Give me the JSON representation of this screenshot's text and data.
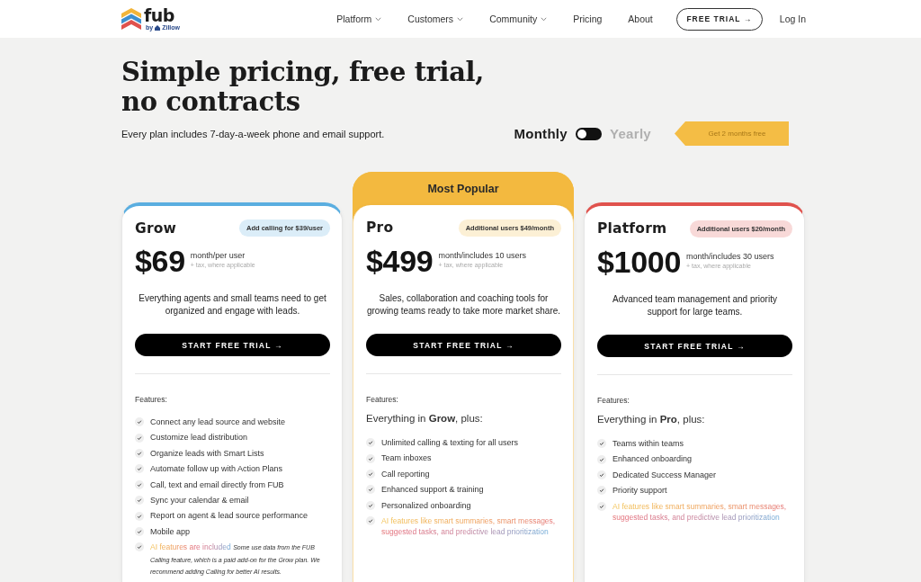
{
  "header": {
    "brand": "fub",
    "byline": {
      "prefix": "by",
      "partner": "Zillow"
    },
    "nav": [
      {
        "label": "Platform",
        "has_menu": true
      },
      {
        "label": "Customers",
        "has_menu": true
      },
      {
        "label": "Community",
        "has_menu": true
      },
      {
        "label": "Pricing",
        "has_menu": false
      },
      {
        "label": "About",
        "has_menu": false
      }
    ],
    "trial_button": "FREE TRIAL →",
    "login": "Log In"
  },
  "hero": {
    "title": "Simple pricing, free trial, no contracts",
    "subtitle": "Every plan includes 7-day-a-week phone and email support."
  },
  "billing": {
    "options": [
      {
        "label": "Monthly",
        "selected": true
      },
      {
        "label": "Yearly",
        "selected": false
      }
    ],
    "promo": "Get 2 months free"
  },
  "plans": [
    {
      "name": "Grow",
      "color": "#5aaee0",
      "badge": "Add calling for $39/user",
      "price": "$69",
      "period": "month/per user",
      "tax": "+ tax, where applicable",
      "description": "Everything agents and small teams need to get organized and engage with leads.",
      "cta": "START FREE TRIAL →",
      "features_label": "Features:",
      "features": [
        {
          "kind": "plain",
          "text": "Connect any lead source and website"
        },
        {
          "kind": "plain",
          "text": "Customize lead distribution"
        },
        {
          "kind": "plain",
          "text": "Organize leads with Smart Lists"
        },
        {
          "kind": "plain",
          "text": "Automate follow up with Action Plans"
        },
        {
          "kind": "plain",
          "text": "Call, text and email directly from FUB"
        },
        {
          "kind": "plain",
          "text": "Sync your calendar & email"
        },
        {
          "kind": "plain",
          "text": "Report on agent & lead source performance"
        },
        {
          "kind": "plain",
          "text": "Mobile app"
        },
        {
          "kind": "ai",
          "text": "AI features are included",
          "note": "Some use data from the FUB Calling feature, which is a paid add-on for the Grow plan. We recommend adding Calling for better AI results."
        }
      ]
    },
    {
      "name": "Pro",
      "ribbon": "Most Popular",
      "color": "#f3b93f",
      "badge": "Additional users $49/month",
      "price": "$499",
      "period": "month/includes 10 users",
      "tax": "+ tax, where applicable",
      "description": "Sales, collaboration and coaching tools for growing teams ready to take more market share.",
      "cta": "START FREE TRIAL →",
      "features_label": "Features:",
      "intro": "Everything in **Grow**, plus:",
      "features": [
        {
          "kind": "plain",
          "text": "Unlimited calling & texting for all users"
        },
        {
          "kind": "plain",
          "text": "Team inboxes"
        },
        {
          "kind": "plain",
          "text": "Call reporting"
        },
        {
          "kind": "plain",
          "text": "Enhanced support & training"
        },
        {
          "kind": "plain",
          "text": "Personalized onboarding"
        },
        {
          "kind": "ai",
          "text": "AI features like smart summaries, smart messages, suggested tasks, and predictive lead prioritization"
        }
      ]
    },
    {
      "name": "Platform",
      "color": "#e0524d",
      "badge": "Additional users $20/month",
      "price": "$1000",
      "period": "month/includes 30 users",
      "tax": "+ tax, where applicable",
      "description": "Advanced team management and priority support for large teams.",
      "cta": "START FREE TRIAL →",
      "features_label": "Features:",
      "intro": "Everything in **Pro**, plus:",
      "features": [
        {
          "kind": "plain",
          "text": "Teams within teams"
        },
        {
          "kind": "plain",
          "text": "Enhanced onboarding"
        },
        {
          "kind": "plain",
          "text": "Dedicated Success Manager"
        },
        {
          "kind": "plain",
          "text": "Priority support"
        },
        {
          "kind": "ai",
          "text": "AI features like smart summaries, smart messages, suggested tasks, and predictive lead prioritization"
        }
      ]
    }
  ]
}
